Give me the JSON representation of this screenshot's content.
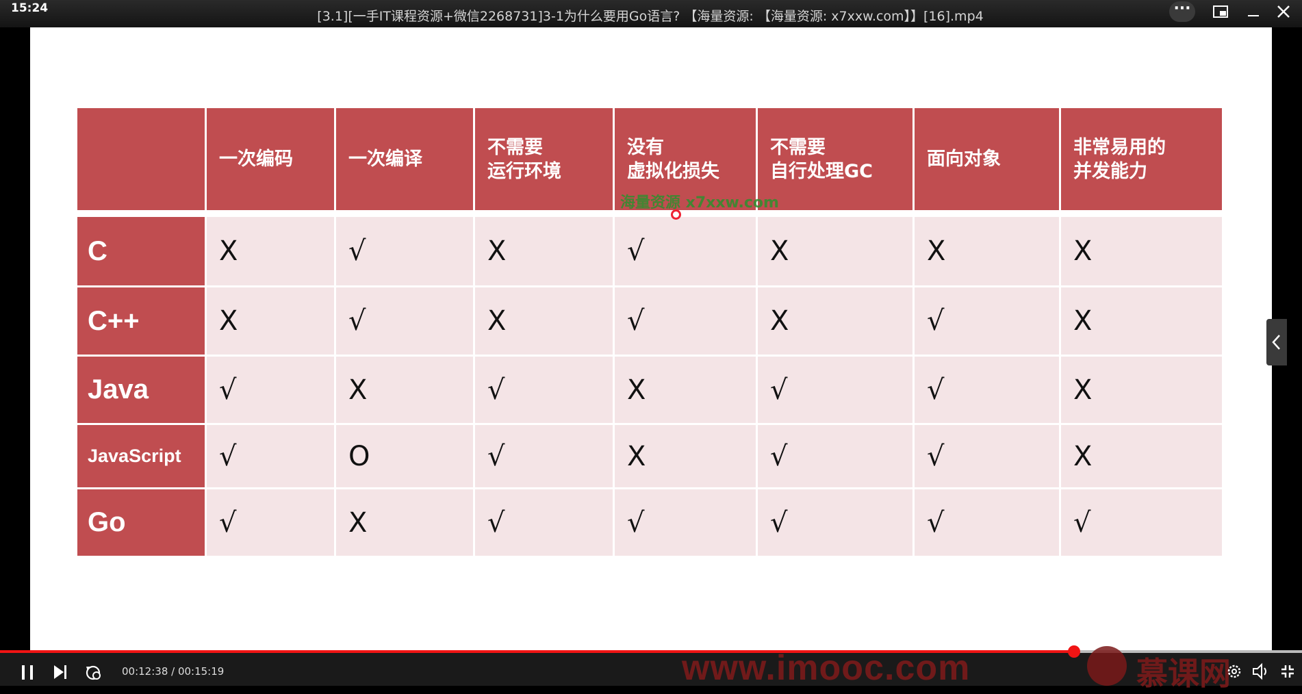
{
  "window": {
    "clock": "15:24",
    "title": "[3.1][一手IT课程资源+微信2268731]3-1为什么要用Go语言? 【海量资源: 【海量资源: x7xxw.com】】[16].mp4",
    "more_label": "···"
  },
  "table": {
    "headers": [
      "",
      "一次编码",
      "一次编译",
      "不需要\n运行环境",
      "没有\n虚拟化损失",
      "不需要\n自行处理GC",
      "面向对象",
      "非常易用的\n并发能力"
    ],
    "rows": [
      {
        "lang": "C",
        "values": [
          "X",
          "√",
          "X",
          "√",
          "X",
          "X",
          "X"
        ]
      },
      {
        "lang": "C++",
        "values": [
          "X",
          "√",
          "X",
          "√",
          "X",
          "√",
          "X"
        ]
      },
      {
        "lang": "Java",
        "values": [
          "√",
          "X",
          "√",
          "X",
          "√",
          "√",
          "X"
        ]
      },
      {
        "lang": "JavaScript",
        "values": [
          "√",
          "O",
          "√",
          "X",
          "√",
          "√",
          "X"
        ]
      },
      {
        "lang": "Go",
        "values": [
          "√",
          "X",
          "√",
          "√",
          "√",
          "√",
          "√"
        ]
      }
    ],
    "watermark": "海量资源 x7xxw.com"
  },
  "player": {
    "current_time": "00:12:38",
    "total_time": "00:15:19",
    "time_display": "00:12:38 / 00:15:19",
    "progress": 0.825,
    "brand_url": "www.imooc.com",
    "brand_name": "慕课网"
  },
  "colors": {
    "header_bg": "#c04d50",
    "cell_bg": "#f4e4e6",
    "progress": "#f01414"
  },
  "icons": [
    "more-icon",
    "pip-icon",
    "minimize-icon",
    "close-icon",
    "collapse-panel-icon",
    "pause-icon",
    "next-icon",
    "loop-icon",
    "settings-icon",
    "volume-icon",
    "fullscreen-exit-icon"
  ]
}
